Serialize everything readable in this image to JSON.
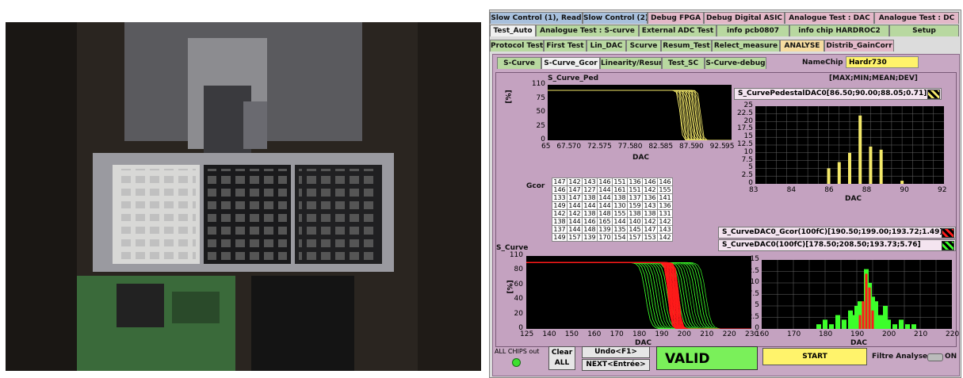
{
  "tabs_row1": [
    "Slow Control (1), Read",
    "Slow Control (2)",
    "Debug FPGA",
    "Debug Digital ASIC",
    "Analogue Test : DAC",
    "Analogue Test : DC"
  ],
  "tabs_row2": [
    "Test_Auto",
    "Analogue Test : S-curve",
    "External ADC Test",
    "info pcb0807",
    "info chip HARDROC2",
    "Setup"
  ],
  "tabs_row3": [
    "Protocol Test",
    "First Test",
    "Lin_DAC",
    "Scurve",
    "Resum_Test",
    "Relect_measure",
    "ANALYSE",
    "Distrib_GainCorr"
  ],
  "tabs_row4": [
    "S-Curve",
    "S-Curve_Gcor",
    "Linearity/Resum",
    "Test_SC",
    "S-Curve-debug"
  ],
  "namechip": {
    "label": "NameChip",
    "value": "Hardr730"
  },
  "stats_header": "[MAX;MIN;MEAN;DEV]",
  "ped": {
    "title": "S_Curve_Ped",
    "ylabel": "[%]",
    "xlabel": "DAC",
    "yticks": [
      "110",
      "75",
      "50",
      "25",
      "0"
    ],
    "xticks": [
      "65",
      "67.5",
      "70",
      "72.5",
      "75",
      "77.5",
      "80",
      "82.5",
      "85",
      "87.5",
      "90",
      "92.5",
      "95"
    ]
  },
  "ped_hist": {
    "legend": "S_CurvePedestalDAC0[86.50;90.00;88.05;0.71]",
    "yticks": [
      "25",
      "22.5",
      "20",
      "17.5",
      "15",
      "12.5",
      "10",
      "7.5",
      "5",
      "2.5",
      "0"
    ],
    "xticks": [
      "83",
      "84",
      "86",
      "88",
      "90",
      "92"
    ],
    "xlabel": "DAC"
  },
  "gcor": {
    "label": "Gcor",
    "rows": [
      [
        "147",
        "142",
        "143",
        "146",
        "151",
        "136",
        "146",
        "146"
      ],
      [
        "146",
        "147",
        "127",
        "144",
        "161",
        "151",
        "142",
        "155"
      ],
      [
        "133",
        "147",
        "138",
        "144",
        "138",
        "137",
        "136",
        "141"
      ],
      [
        "149",
        "144",
        "144",
        "144",
        "130",
        "159",
        "143",
        "136"
      ],
      [
        "142",
        "142",
        "138",
        "148",
        "155",
        "138",
        "138",
        "131"
      ],
      [
        "138",
        "144",
        "146",
        "165",
        "144",
        "140",
        "142",
        "142"
      ],
      [
        "137",
        "144",
        "148",
        "139",
        "135",
        "145",
        "147",
        "143"
      ],
      [
        "149",
        "157",
        "139",
        "170",
        "154",
        "157",
        "153",
        "142"
      ]
    ]
  },
  "legend2": [
    "S_CurveDAC0_Gcor(100fC)[190.50;199.00;193.72;1.49]",
    "S_CurveDAC0(100fC)[178.50;208.50;193.73;5.76]"
  ],
  "scurve": {
    "title": "S_Curve",
    "ylabel": "[%]",
    "xlabel": "DAC",
    "yticks": [
      "110",
      "80",
      "60",
      "40",
      "20",
      "0"
    ],
    "xticks": [
      "125",
      "140",
      "150",
      "160",
      "170",
      "180",
      "190",
      "200",
      "210",
      "220",
      "230"
    ]
  },
  "scurve_hist": {
    "yticks": [
      "15",
      "12.5",
      "10",
      "7.5",
      "5",
      "2.5",
      "0"
    ],
    "xticks": [
      "160",
      "170",
      "180",
      "190",
      "200",
      "210",
      "220"
    ],
    "xlabel": "DAC"
  },
  "bottom": {
    "all_chips": "ALL CHIPS out",
    "clear": "Clear",
    "clear2": "ALL",
    "undo": "Undo<F1>",
    "next": "NEXT<Entrée>",
    "status": "VALID",
    "start": "START",
    "filter": "Filtre Analyse",
    "on": "ON"
  },
  "colors": {
    "yellow": "#f4e96a",
    "red": "#ff1a1a",
    "green": "#3cff2a",
    "status": "#7af05a"
  },
  "chart_data": [
    {
      "type": "bar",
      "x": [
        86.5,
        87,
        87.5,
        88,
        88.5,
        89,
        90
      ],
      "values": [
        5,
        7,
        10,
        22,
        12,
        11,
        1
      ],
      "xlim": [
        83,
        92
      ],
      "ylim": [
        0,
        25
      ],
      "xlabel": "DAC"
    },
    {
      "type": "bar",
      "x": [
        178,
        180,
        182,
        184,
        186,
        188,
        189,
        190,
        191,
        192,
        193,
        194,
        195,
        196,
        197,
        198,
        199,
        200,
        202,
        204,
        206,
        208
      ],
      "series": [
        {
          "values": [
            1,
            2,
            1,
            3,
            2,
            4,
            3,
            5,
            6,
            5,
            13,
            10,
            7,
            6,
            3,
            3,
            5,
            2,
            1,
            2,
            1,
            1
          ]
        }
      ],
      "xlim": [
        160,
        220
      ],
      "ylim": [
        0,
        15
      ],
      "xlabel": "DAC"
    }
  ]
}
